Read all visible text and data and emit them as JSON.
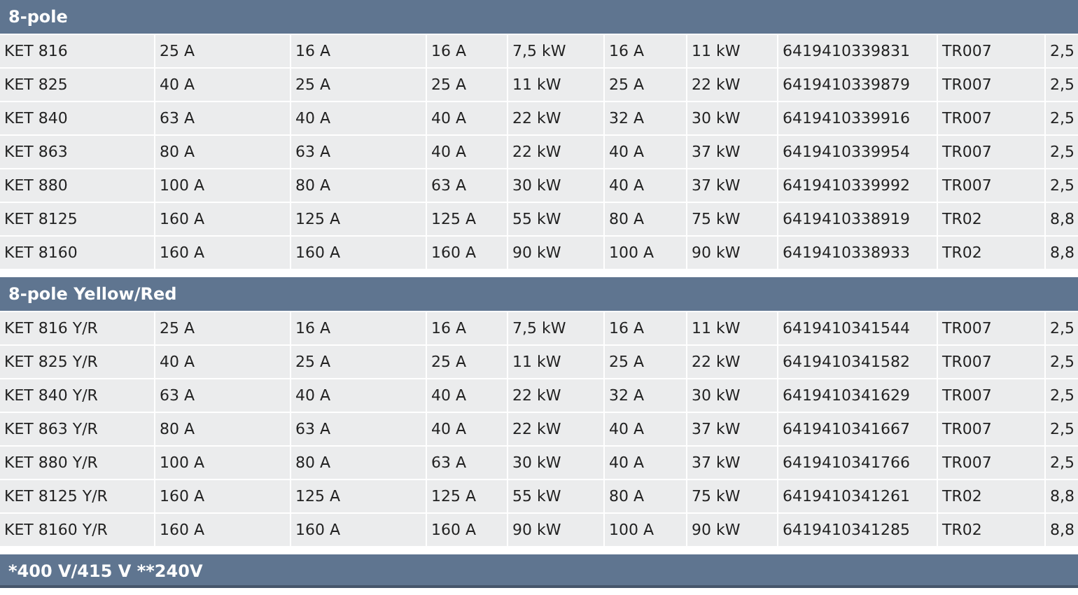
{
  "sections": [
    {
      "title": "8-pole",
      "rows": [
        [
          "KET 816",
          "25 A",
          "16 A",
          "16 A",
          "7,5 kW",
          "16 A",
          "11 kW",
          "6419410339831",
          "TR007",
          "2,5"
        ],
        [
          "KET 825",
          "40 A",
          "25 A",
          "25 A",
          "11 kW",
          "25 A",
          "22 kW",
          "6419410339879",
          "TR007",
          "2,5"
        ],
        [
          "KET 840",
          "63 A",
          "40 A",
          "40 A",
          "22 kW",
          "32 A",
          "30 kW",
          "6419410339916",
          "TR007",
          "2,5"
        ],
        [
          "KET 863",
          "80 A",
          "63 A",
          "40 A",
          "22 kW",
          "40 A",
          "37 kW",
          "6419410339954",
          "TR007",
          "2,5"
        ],
        [
          "KET 880",
          "100 A",
          "80 A",
          "63 A",
          "30 kW",
          "40 A",
          "37 kW",
          "6419410339992",
          "TR007",
          "2,5"
        ],
        [
          "KET 8125",
          "160 A",
          "125 A",
          "125 A",
          "55 kW",
          "80 A",
          "75 kW",
          "6419410338919",
          "TR02",
          "8,8"
        ],
        [
          "KET 8160",
          "160 A",
          "160 A",
          "160 A",
          "90 kW",
          "100 A",
          "90 kW",
          "6419410338933",
          "TR02",
          "8,8"
        ]
      ]
    },
    {
      "title": "8-pole Yellow/Red",
      "rows": [
        [
          "KET 816 Y/R",
          "25 A",
          "16 A",
          "16 A",
          "7,5 kW",
          "16 A",
          "11 kW",
          "6419410341544",
          "TR007",
          "2,5"
        ],
        [
          "KET 825 Y/R",
          "40 A",
          "25 A",
          "25 A",
          "11 kW",
          "25 A",
          "22 kW",
          "6419410341582",
          "TR007",
          "2,5"
        ],
        [
          "KET 840 Y/R",
          "63 A",
          "40 A",
          "40 A",
          "22 kW",
          "32 A",
          "30 kW",
          "6419410341629",
          "TR007",
          "2,5"
        ],
        [
          "KET 863 Y/R",
          "80 A",
          "63 A",
          "40 A",
          "22 kW",
          "40 A",
          "37 kW",
          "6419410341667",
          "TR007",
          "2,5"
        ],
        [
          "KET 880 Y/R",
          "100 A",
          "80 A",
          "63 A",
          "30 kW",
          "40 A",
          "37 kW",
          "6419410341766",
          "TR007",
          "2,5"
        ],
        [
          "KET 8125 Y/R",
          "160 A",
          "125 A",
          "125 A",
          "55 kW",
          "80 A",
          "75 kW",
          "6419410341261",
          "TR02",
          "8,8"
        ],
        [
          "KET 8160 Y/R",
          "160 A",
          "160 A",
          "160 A",
          "90 kW",
          "100 A",
          "90 kW",
          "6419410341285",
          "TR02",
          "8,8"
        ]
      ]
    }
  ],
  "footer": "*400 V/415 V **240V"
}
